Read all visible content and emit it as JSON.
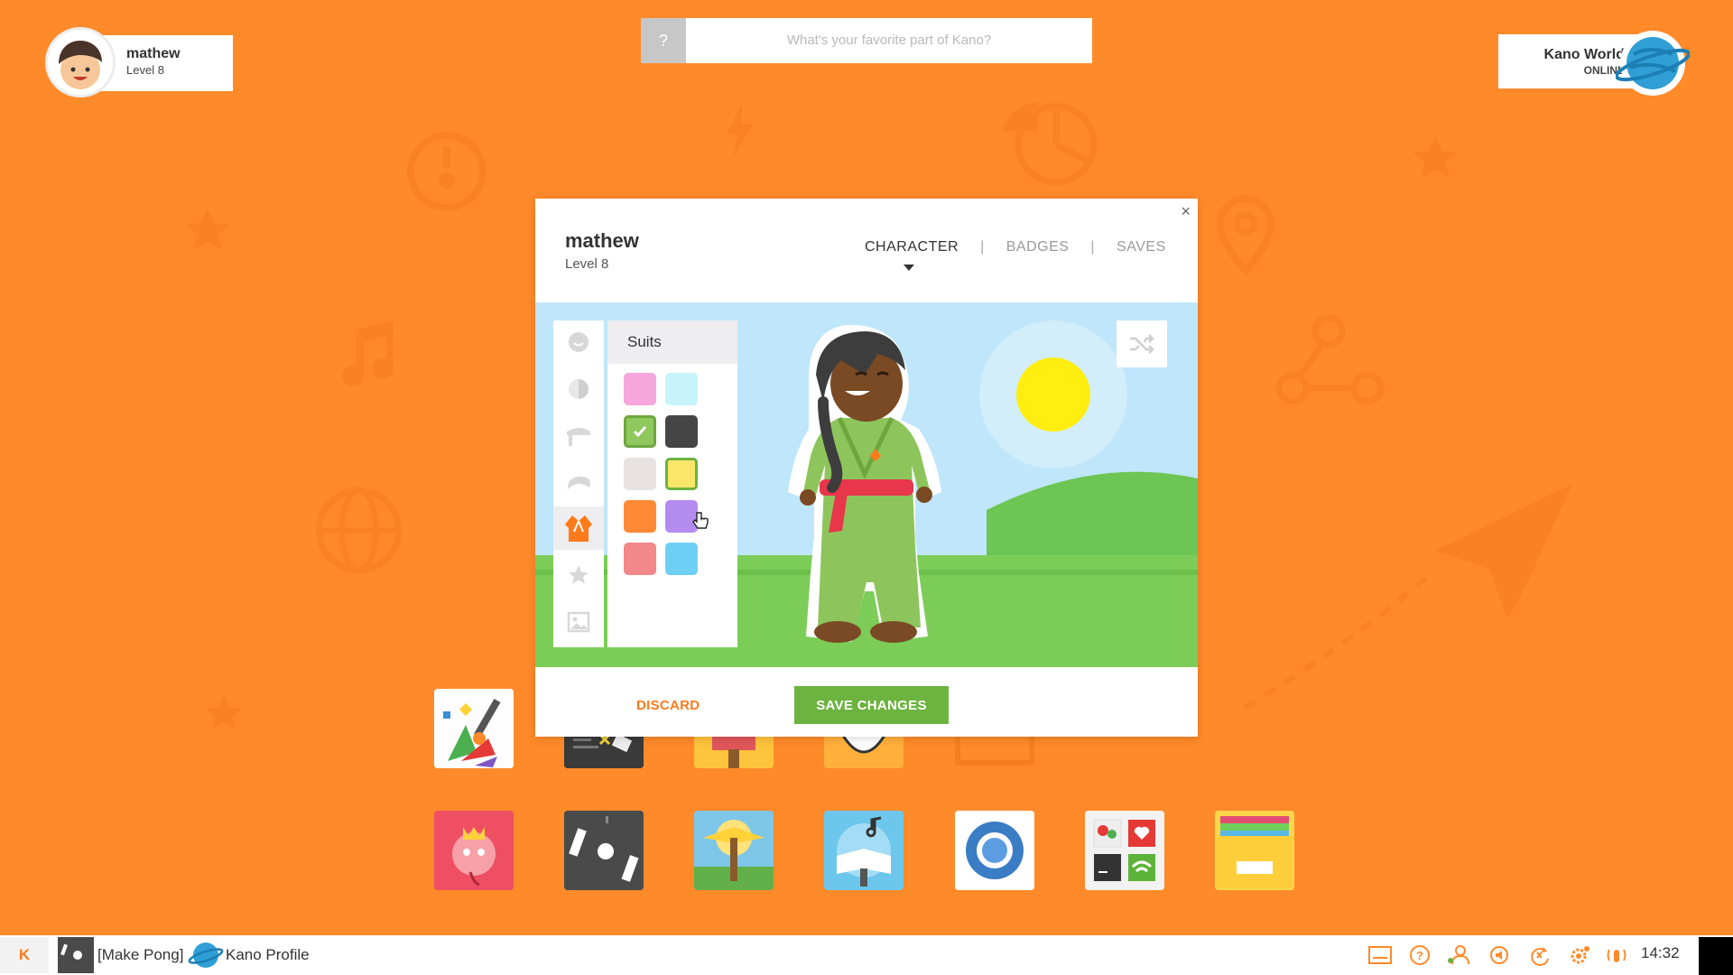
{
  "user": {
    "name": "mathew",
    "level": "Level 8"
  },
  "search": {
    "button": "?",
    "placeholder": "What's your favorite part of Kano?"
  },
  "world": {
    "title": "Kano World",
    "status": "ONLINE"
  },
  "modal": {
    "close": "×",
    "name": "mathew",
    "level": "Level 8",
    "tabs": [
      "CHARACTER",
      "BADGES",
      "SAVES"
    ],
    "active_tab": "CHARACTER",
    "panel_title": "Suits",
    "swatches": [
      "#f5a6dc",
      "#c7f4fb",
      "#8fc85d",
      "#454545",
      "#e9e2e2",
      "#fbe66a",
      "#ff8a35",
      "#b48cf0",
      "#f3888a",
      "#6fd0f5"
    ],
    "selected_swatch": 2,
    "hovered_swatch": 5,
    "discard": "DISCARD",
    "save": "SAVE CHANGES"
  },
  "apps": [
    "paint-app",
    "code-app",
    "adventures-app",
    "face-app",
    "apps-frame",
    "document-app",
    "snake-app",
    "pong-app",
    "minecraft-app",
    "music-app",
    "chromium-app",
    "settings-app",
    "files-app"
  ],
  "taskbar": {
    "start": "K",
    "items": [
      "[Make Pong]",
      "Kano Profile"
    ],
    "clock": "14:32"
  }
}
